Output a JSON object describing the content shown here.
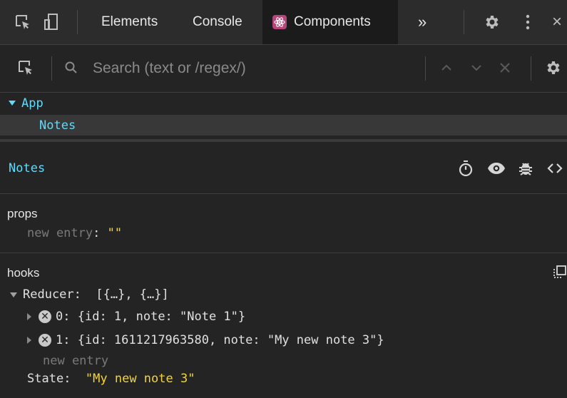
{
  "tabbar": {
    "tabs": [
      {
        "label": "Elements"
      },
      {
        "label": "Console"
      },
      {
        "label": "Components"
      }
    ],
    "more_label": "»",
    "close_label": "×"
  },
  "search": {
    "placeholder": "Search (text or /regex/)"
  },
  "tree": {
    "items": [
      {
        "label": "App"
      },
      {
        "label": "Notes"
      }
    ]
  },
  "inspector": {
    "selected_name": "Notes",
    "props": {
      "title": "props",
      "new_entry_key": "new entry",
      "new_entry_value": "\"\""
    },
    "hooks": {
      "title": "hooks",
      "reducer_key": "Reducer",
      "reducer_value": "[{…}, {…}]",
      "items": [
        {
          "index": "0",
          "value": "{id: 1, note: \"Note 1\"}"
        },
        {
          "index": "1",
          "value": "{id: 1611217963580, note: \"My new note 3\"}"
        }
      ],
      "new_entry_label": "new entry",
      "state_key": "State",
      "state_value": "\"My new note 3\""
    }
  },
  "colors": {
    "background": "#242424",
    "accent_blue": "#61dafb",
    "string_yellow": "#f2d43d",
    "react_badge": "#b5467a"
  },
  "icons": {
    "inspect": "inspect-element-icon",
    "device": "device-toolbar-icon",
    "settings": "gear-icon",
    "kebab": "vertical-dots-icon",
    "search": "magnifier-icon",
    "timer": "stopwatch-icon",
    "eye": "eye-icon",
    "bug": "bug-icon",
    "code": "code-brackets-icon",
    "copy": "copy-icon"
  }
}
